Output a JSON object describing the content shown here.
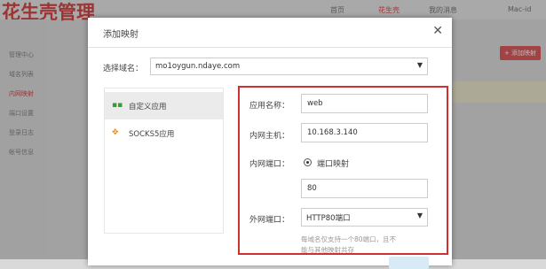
{
  "app": {
    "brand": "花生壳管理",
    "nav": [
      "首页",
      "花生壳",
      "我的消息",
      "Mac-id"
    ],
    "sidebar": [
      "管理中心",
      "域名列表",
      "内网映射",
      "端口设置",
      "登录日志",
      "帐号信息"
    ],
    "action_label": "+ 添加映射"
  },
  "dialog": {
    "title": "添加映射",
    "close_icon": "close-icon",
    "domain_label": "选择域名：",
    "domain_value": "mo1oygun.ndaye.com",
    "tabs": [
      {
        "label": "自定义应用",
        "icon": "grid-icon",
        "active": true
      },
      {
        "label": "SOCKS5应用",
        "icon": "plugin-icon",
        "active": false
      }
    ],
    "form": {
      "app_name_label": "应用名称：",
      "app_name_value": "web",
      "host_label": "内网主机：",
      "host_value": "10.168.3.140",
      "port_label": "内网端口：",
      "port_mode_label": "端口映射",
      "port_value": "80",
      "ext_port_label": "外网端口：",
      "ext_port_value": "HTTP80端口",
      "note_line1": "每域名仅支持一个80端口，且不",
      "note_line2": "能与其他映射共存"
    }
  },
  "colors": {
    "brand": "#d23030",
    "highlight_box": "#d03030",
    "action_button": "#d8474a"
  }
}
